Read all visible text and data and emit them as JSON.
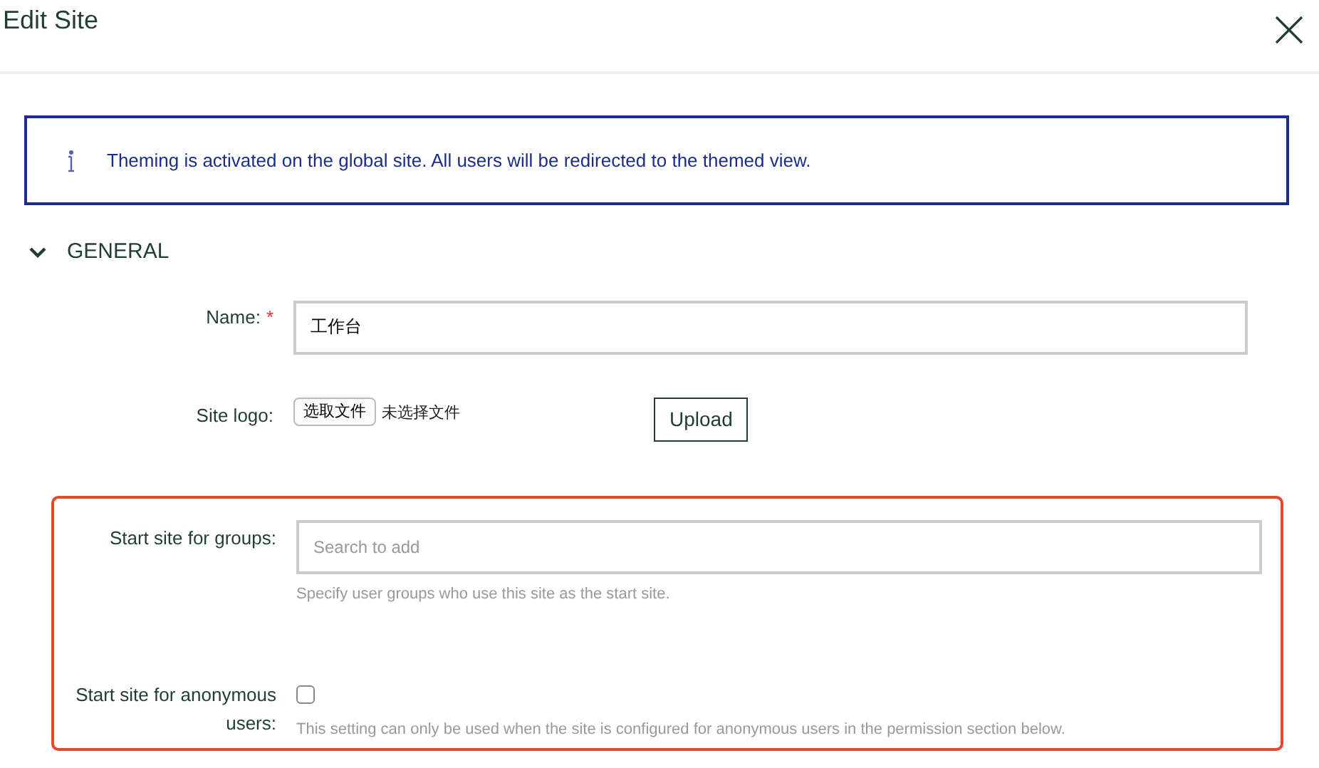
{
  "dialog": {
    "title": "Edit Site"
  },
  "alert": {
    "text": "Theming is activated on the global site. All users will be redirected to the themed view."
  },
  "section": {
    "title": "GENERAL",
    "expanded": true
  },
  "fields": [
    {
      "kind": "text",
      "label": "Name:",
      "required_mark": "*",
      "value": "工作台"
    },
    {
      "kind": "file",
      "label": "Site logo:",
      "choose_button": "选取文件",
      "file_status": "未选择文件",
      "upload_button": "Upload"
    }
  ],
  "highlight_box": {
    "fields": [
      {
        "kind": "search",
        "label": "Start site for groups:",
        "placeholder": "Search to add",
        "help": "Specify user groups who use this site as the start site."
      },
      {
        "kind": "checkbox",
        "label": "Start site for anonymous users:",
        "checked": false,
        "help": "This setting can only be used when the site is configured for anonymous users in the permission section below."
      }
    ]
  }
}
